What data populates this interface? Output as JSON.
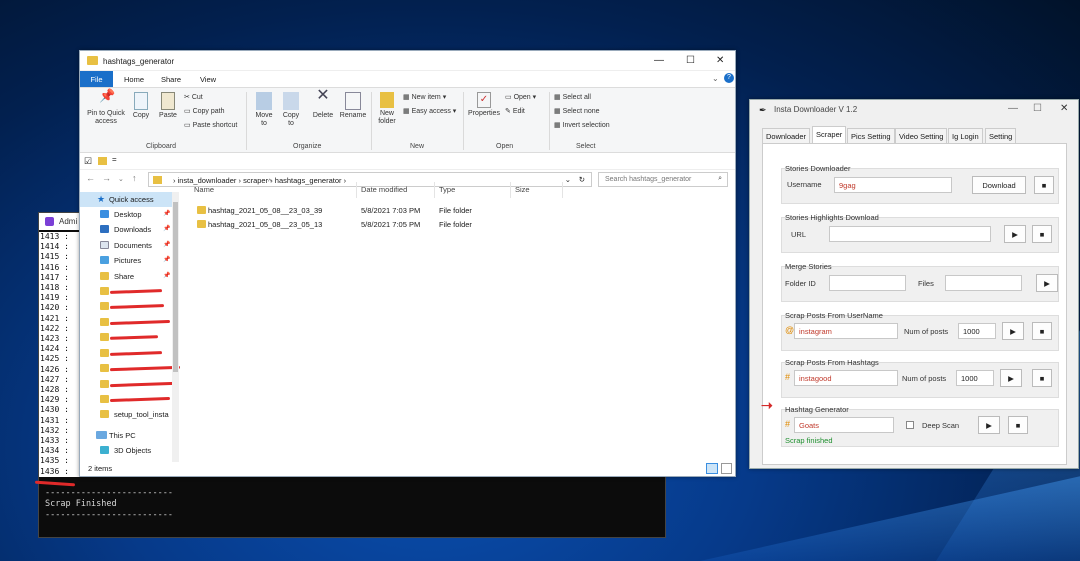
{
  "console": {
    "title": "Admi",
    "line_numbers": [
      "1413 :",
      "1414 :",
      "1415 :",
      "1416 :",
      "1417 :",
      "1418 :",
      "1419 :",
      "1420 :",
      "1421 :",
      "1422 :",
      "1423 :",
      "1424 :",
      "1425 :",
      "1426 :",
      "1427 :",
      "1428 :",
      "1429 :",
      "1430 :",
      "1431 :",
      "1432 :",
      "1433 :",
      "1434 :",
      "1435 :",
      "1436 :"
    ],
    "divider": "-------------------------",
    "message": "Scrap Finished"
  },
  "explorer": {
    "title": "hashtags_generator",
    "tabs": [
      "File",
      "Home",
      "Share",
      "View"
    ],
    "ribbon": {
      "pin": "Pin to Quick access",
      "copy": "Copy",
      "paste": "Paste",
      "cut": "Cut",
      "copy_path": "Copy path",
      "paste_shortcut": "Paste shortcut",
      "clipboard": "Clipboard",
      "move_to": "Move to",
      "copy_to": "Copy to",
      "delete": "Delete",
      "rename": "Rename",
      "organize": "Organize",
      "new_folder": "New folder",
      "new_item": "New item",
      "easy_access": "Easy access",
      "new": "New",
      "properties": "Properties",
      "open": "Open",
      "edit": "Edit",
      "open_group": "Open",
      "select_all": "Select all",
      "select_none": "Select none",
      "invert_selection": "Invert selection",
      "select": "Select"
    },
    "breadcrumb": [
      "insta_downloader",
      "scraper",
      "hashtags_generator"
    ],
    "search_placeholder": "Search hashtags_generator",
    "nav": [
      {
        "label": "Quick access"
      },
      {
        "label": "Desktop"
      },
      {
        "label": "Downloads"
      },
      {
        "label": "Documents"
      },
      {
        "label": "Pictures"
      },
      {
        "label": "Share"
      },
      {
        "label": "setup_tool_insta"
      },
      {
        "label": "This PC"
      },
      {
        "label": "3D Objects"
      }
    ],
    "columns": [
      "Name",
      "Date modified",
      "Type",
      "Size"
    ],
    "files": [
      {
        "name": "hashtag_2021_05_08__23_03_39",
        "date": "5/8/2021 7:03 PM",
        "type": "File folder"
      },
      {
        "name": "hashtag_2021_05_08__23_05_13",
        "date": "5/8/2021 7:05 PM",
        "type": "File folder"
      }
    ],
    "status": "2 items"
  },
  "insta": {
    "title": "Insta Downloader V 1.2",
    "tabs": [
      "Downloader",
      "Scraper",
      "Pics Setting",
      "Video Setting",
      "Ig Login",
      "Setting"
    ],
    "stories": {
      "title": "Stories Downloader",
      "username_label": "Username",
      "username_value": "9gag",
      "download": "Download"
    },
    "highlights": {
      "title": "Stories Highlights Download",
      "url_label": "URL"
    },
    "merge": {
      "title": "Merge Stories",
      "folder_label": "Folder ID",
      "files_label": "Files"
    },
    "scrap_user": {
      "title": "Scrap Posts From UserName",
      "value": "instagram",
      "num_label": "Num of posts",
      "num": "1000"
    },
    "scrap_hashtag": {
      "title": "Scrap Posts From Hashtags",
      "value": "instagood",
      "num_label": "Num of posts",
      "num": "1000"
    },
    "hashtag_gen": {
      "title": "Hashtag Generator",
      "value": "Goats",
      "deep_scan": "Deep Scan",
      "status": "Scrap finished"
    },
    "colors": {
      "accent_orange": "#e08a00",
      "value_red": "#c0392b",
      "status_green": "#1e8f2e"
    }
  }
}
